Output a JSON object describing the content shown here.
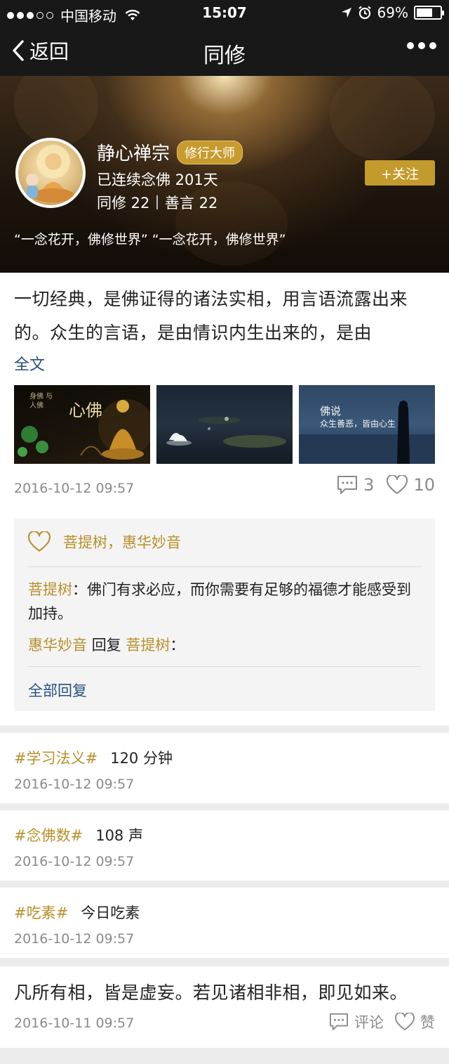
{
  "status_bar": {
    "carrier": "中国移动",
    "time": "15:07",
    "battery": "69%",
    "battery_level": 0.69
  },
  "nav": {
    "back_label": "返回",
    "title": "同修"
  },
  "profile": {
    "name": "静心禅宗",
    "badge": "修行大师",
    "streak": "已连续念佛 201天",
    "stat_fellow": "同修 22",
    "stat_words": "善言 22",
    "follow_label": "+关注",
    "quote": "“一念花开，佛修世界”  “一念花开，佛修世界”"
  },
  "post": {
    "text": "一切经典，是佛证得的诸法实相，用言语流露出来的。众生的言语，是由情识内生出来的，是由",
    "more_label": "全文",
    "images": [
      {
        "caption_big": "心佛",
        "caption_small": "身佛 与 人佛"
      },
      {
        "caption_big": "",
        "caption_small": ""
      },
      {
        "caption_big": "佛说",
        "caption_small": "众生善恶，皆由心生"
      }
    ],
    "time": "2016-10-12 09:57",
    "comment_count": "3",
    "like_count": "10",
    "likers": "菩提树，惠华妙音",
    "comments": [
      {
        "author": "菩提树",
        "text": "：佛门有求必应，而你需要有足够的福德才能感受到加持。"
      },
      {
        "author": "惠华妙音",
        "reply_label": "回复",
        "reply_to": "菩提树",
        "text": "："
      }
    ],
    "all_replies_label": "全部回复"
  },
  "records": [
    {
      "tag": "#学习法义#",
      "value": "120 分钟",
      "time": "2016-10-12 09:57"
    },
    {
      "tag": "#念佛数#",
      "value": "108 声",
      "time": "2016-10-12 09:57"
    },
    {
      "tag": "#吃素#",
      "value": "今日吃素",
      "time": "2016-10-12 09:57"
    }
  ],
  "post2": {
    "text": "凡所有相，皆是虚妄。若见诸相非相，即见如来。",
    "time": "2016-10-11 09:57",
    "comment_label": "评论",
    "like_label": "赞"
  },
  "colors": {
    "gold": "#b8902a",
    "link": "#244f80",
    "nav_bg": "#181818"
  }
}
